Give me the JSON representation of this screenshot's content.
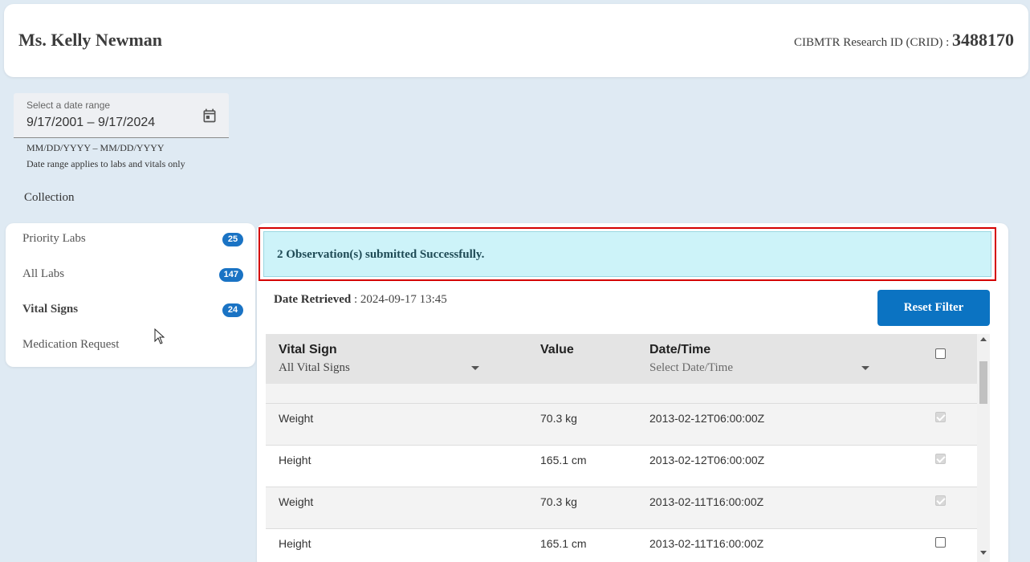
{
  "header": {
    "patient_name": "Ms. Kelly Newman",
    "crid_label": "CIBMTR Research ID (CRID) :",
    "crid_value": "3488170"
  },
  "date_range": {
    "label": "Select a date range",
    "value": "9/17/2001  – 9/17/2024",
    "format_hint": "MM/DD/YYYY – MM/DD/YYYY",
    "note": "Date range applies to labs and vitals only"
  },
  "collection_label": "Collection",
  "sidebar": {
    "items": [
      {
        "label": "Priority Labs",
        "count": "25",
        "active": false
      },
      {
        "label": "All Labs",
        "count": "147",
        "active": false
      },
      {
        "label": "Vital Signs",
        "count": "24",
        "active": true
      },
      {
        "label": "Medication Request",
        "count": null,
        "active": false
      }
    ]
  },
  "alert": {
    "message": "2 Observation(s) submitted Successfully.",
    "outline_color": "#d40000",
    "background": "#cdf3f9"
  },
  "retrieved": {
    "label": "Date Retrieved",
    "value": ": 2024-09-17 13:45"
  },
  "reset_button": {
    "label": "Reset Filter",
    "color": "#0b73c2"
  },
  "table": {
    "columns": {
      "vital_sign": "Vital Sign",
      "value": "Value",
      "datetime": "Date/Time"
    },
    "filters": {
      "vital_sign": "All Vital Signs",
      "datetime_placeholder": "Select Date/Time"
    },
    "rows": [
      {
        "vital_sign": "Weight",
        "value": "70.3 kg",
        "datetime": "2013-02-12T06:00:00Z",
        "checked": true,
        "disabled": true
      },
      {
        "vital_sign": "Height",
        "value": "165.1 cm",
        "datetime": "2013-02-12T06:00:00Z",
        "checked": true,
        "disabled": true
      },
      {
        "vital_sign": "Weight",
        "value": "70.3 kg",
        "datetime": "2013-02-11T16:00:00Z",
        "checked": true,
        "disabled": true
      },
      {
        "vital_sign": "Height",
        "value": "165.1 cm",
        "datetime": "2013-02-11T16:00:00Z",
        "checked": false,
        "disabled": false
      }
    ]
  },
  "icons": {
    "date_picker": "calendar-icon",
    "filter_dropdown": "caret-down-icon",
    "pointer": "mouse-cursor-icon"
  },
  "colors": {
    "page_bg": "#dfeaf3",
    "badge": "#1a73c4"
  }
}
